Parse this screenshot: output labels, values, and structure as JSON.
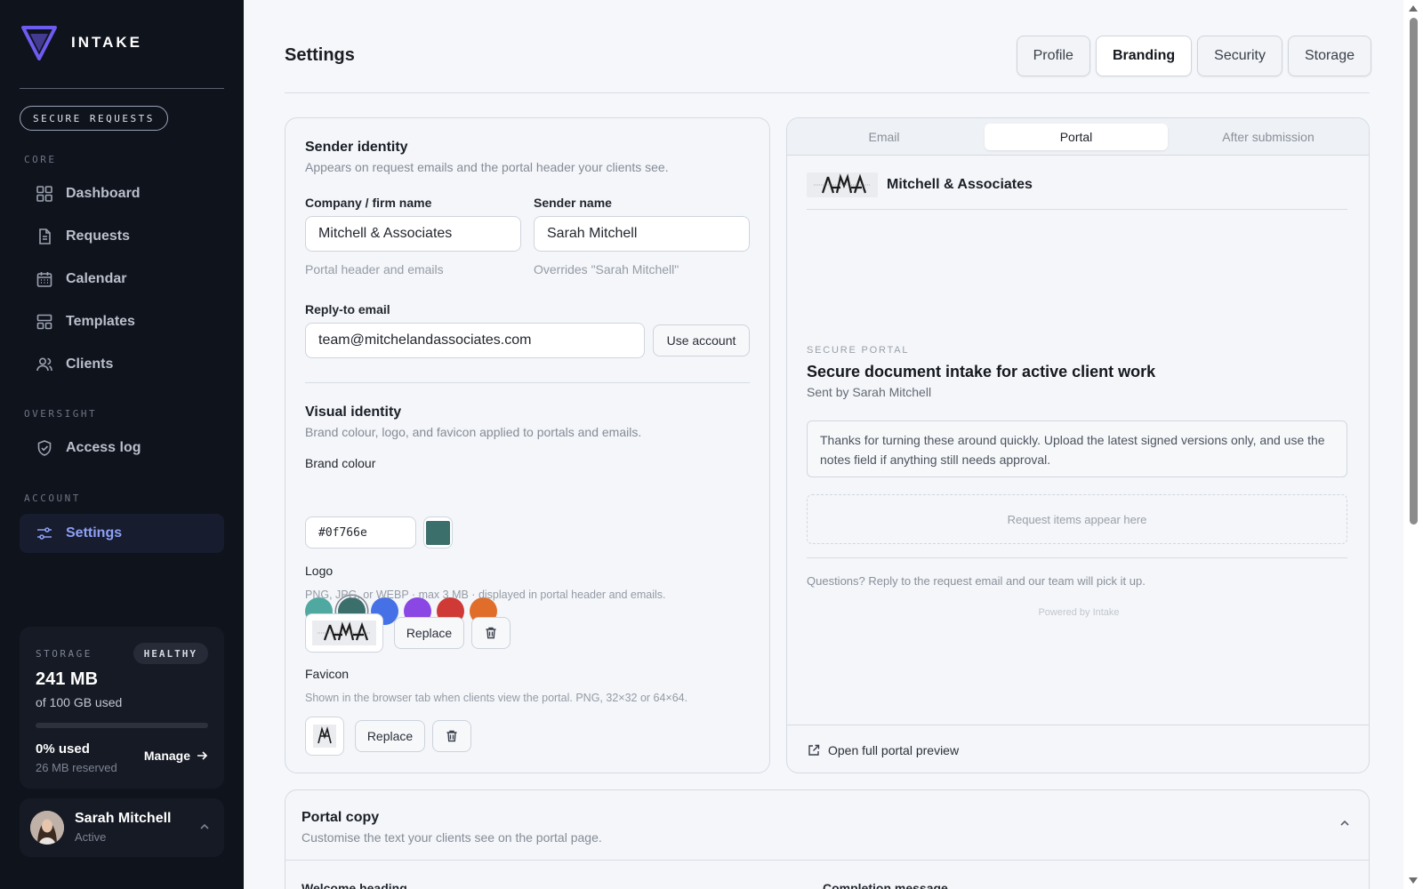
{
  "app": {
    "name": "INTAKE",
    "badge": "SECURE REQUESTS"
  },
  "nav": {
    "sections": {
      "core": "CORE",
      "oversight": "OVERSIGHT",
      "account": "ACCOUNT"
    },
    "items": {
      "dashboard": "Dashboard",
      "requests": "Requests",
      "calendar": "Calendar",
      "templates": "Templates",
      "clients": "Clients",
      "access_log": "Access log",
      "settings": "Settings"
    }
  },
  "storage": {
    "label": "STORAGE",
    "status": "HEALTHY",
    "size": "241 MB",
    "used_of": "of 100 GB used",
    "percent": "0% used",
    "percent_value": 0,
    "reserved": "26 MB reserved",
    "manage": "Manage"
  },
  "user": {
    "name": "Sarah Mitchell",
    "status": "Active"
  },
  "page": {
    "title": "Settings",
    "tabs": [
      "Profile",
      "Branding",
      "Security",
      "Storage"
    ],
    "active_tab": "Branding"
  },
  "sender": {
    "title": "Sender identity",
    "subtitle": "Appears on request emails and the portal header your clients see.",
    "company_label": "Company / firm name",
    "company_value": "Mitchell & Associates",
    "company_hint": "Portal header and emails",
    "sender_label": "Sender name",
    "sender_value": "Sarah Mitchell",
    "sender_hint": "Overrides \"Sarah Mitchell\"",
    "reply_label": "Reply-to email",
    "reply_value": "team@mitchelandassociates.com",
    "use_account": "Use account"
  },
  "visual": {
    "title": "Visual identity",
    "subtitle": "Brand colour, logo, and favicon applied to portals and emails.",
    "brand_colour_label": "Brand colour",
    "swatches": [
      "#4fa9a1",
      "#3b6f6b",
      "#4570e6",
      "#8b47e4",
      "#cf3a36",
      "#e06e2a"
    ],
    "selected_swatch": "#3b6f6b",
    "hex_value": "#0f766e",
    "logo_label": "Logo",
    "logo_hint": "PNG, JPG, or WEBP · max 3 MB · displayed in portal header and emails.",
    "favicon_label": "Favicon",
    "favicon_hint": "Shown in the browser tab when clients view the portal. PNG, 32×32 or 64×64.",
    "replace": "Replace"
  },
  "preview": {
    "tabs": [
      "Email",
      "Portal",
      "After submission"
    ],
    "active_tab": "Portal",
    "firm": "Mitchell & Associates",
    "kicker": "SECURE PORTAL",
    "heading": "Secure document intake for active client work",
    "sent_by": "Sent by Sarah Mitchell",
    "message": "Thanks for turning these around quickly. Upload the latest signed versions only, and use the notes field if anything still needs approval.",
    "items_placeholder": "Request items appear here",
    "questions": "Questions? Reply to the request email and our team will pick it up.",
    "powered": "Powered by Intake",
    "open_full": "Open full portal preview"
  },
  "portal_copy": {
    "title": "Portal copy",
    "subtitle": "Customise the text your clients see on the portal page.",
    "col_welcome": "Welcome heading",
    "col_completion": "Completion message"
  },
  "colors": {
    "accent": "#8ea0f5",
    "sidebar_bg": "#0f131c",
    "brand_logo": "#6d5cf0"
  }
}
